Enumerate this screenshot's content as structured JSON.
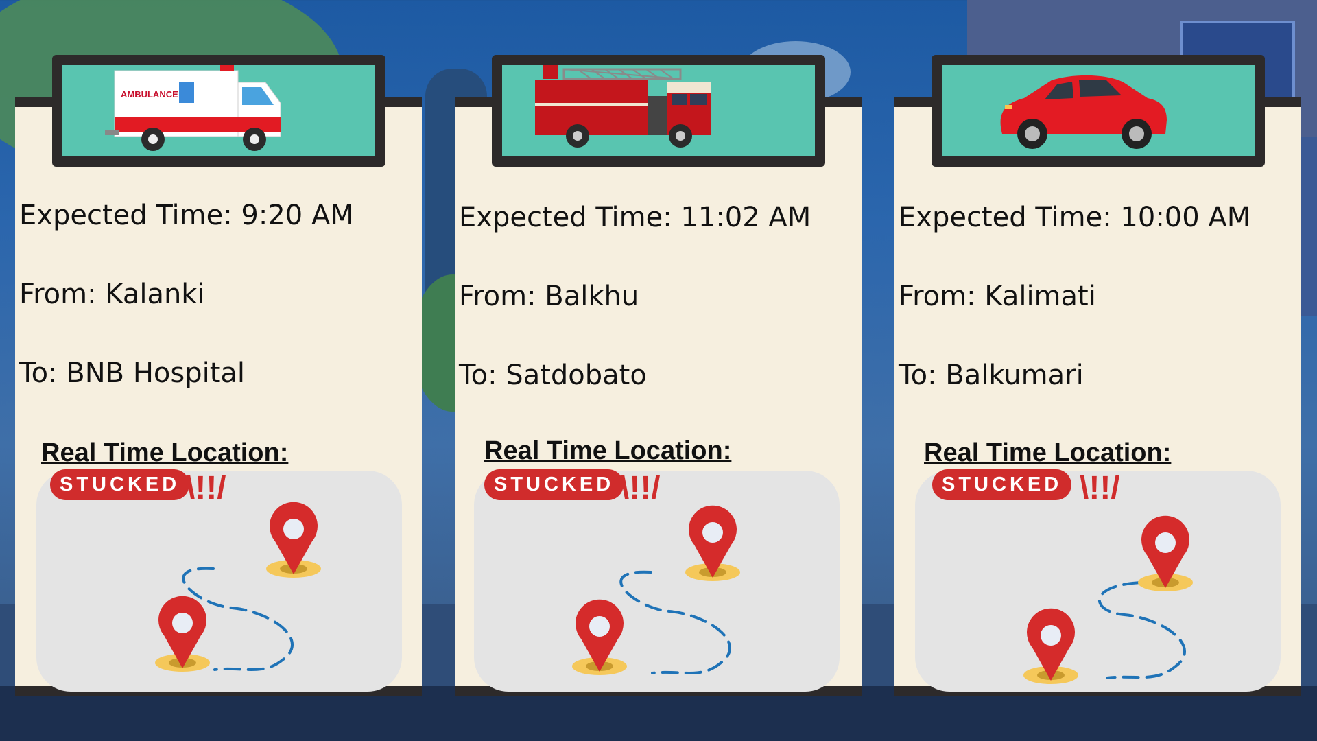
{
  "cards": [
    {
      "vehicle": "ambulance",
      "vehicle_text": "AMBULANCE",
      "expected_time": "Expected Time: 9:20 AM",
      "from": "From: Kalanki",
      "to": "To: BNB Hospital",
      "location_heading": "Real Time Location:",
      "status": "STUCKED",
      "alert": "\\!!/"
    },
    {
      "vehicle": "fire-truck",
      "expected_time": "Expected Time: 11:02 AM",
      "from": "From: Balkhu",
      "to": "To: Satdobato",
      "location_heading": "Real Time Location:",
      "status": "STUCKED",
      "alert": "\\!!/"
    },
    {
      "vehicle": "car",
      "expected_time": "Expected Time: 10:00 AM",
      "from": "From: Kalimati",
      "to": "To: Balkumari",
      "location_heading": "Real Time Location:",
      "status": "STUCKED",
      "alert": "\\!!/"
    }
  ],
  "colors": {
    "card_bg": "#f6efdf",
    "frame": "#2d2a2a",
    "screen": "#59c5b0",
    "map_bg": "#e4e4e4",
    "accent_red": "#d02c2c",
    "route_blue": "#1f73b7",
    "pin_shadow": "#f5c85a"
  }
}
